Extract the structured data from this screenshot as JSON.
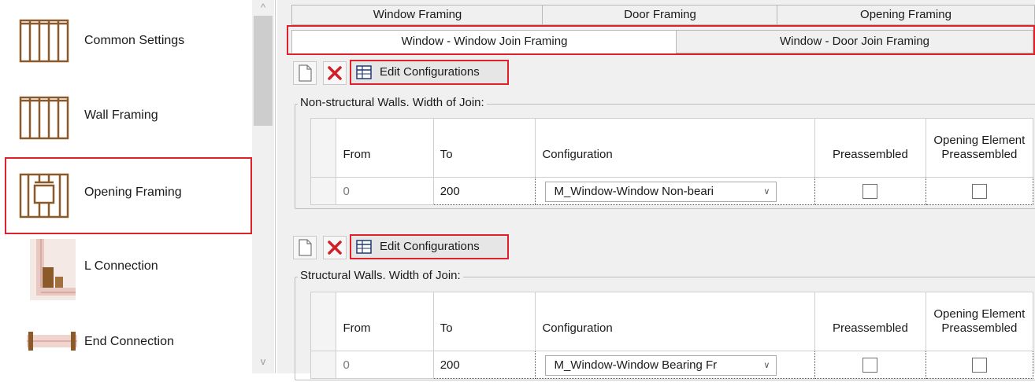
{
  "sidebar": {
    "items": [
      {
        "label": "Common Settings",
        "icon": "wall-framing-icon"
      },
      {
        "label": "Wall Framing",
        "icon": "wall-framing-icon"
      },
      {
        "label": "Opening Framing",
        "icon": "opening-framing-icon"
      },
      {
        "label": "L Connection",
        "icon": "l-connection-icon"
      },
      {
        "label": "End Connection",
        "icon": "end-connection-icon"
      }
    ],
    "scroll_up": "^",
    "scroll_down": "v"
  },
  "tabs": {
    "top": [
      "Window Framing",
      "Door Framing",
      "Opening Framing"
    ],
    "sub": [
      "Window - Window Join Framing",
      "Window - Door Join Framing"
    ]
  },
  "toolbar": {
    "edit_label": "Edit Configurations"
  },
  "sections": [
    {
      "title": "Non-structural Walls. Width of Join:",
      "columns": [
        "From",
        "To",
        "Configuration",
        "Preassembled",
        "Opening Element Preassembled"
      ],
      "row": {
        "from": "0",
        "to": "200",
        "configuration": "M_Window-Window Non-beari"
      }
    },
    {
      "title": "Structural Walls. Width of Join:",
      "columns": [
        "From",
        "To",
        "Configuration",
        "Preassembled",
        "Opening Element Preassembled"
      ],
      "row": {
        "from": "0",
        "to": "200",
        "configuration": "M_Window-Window Bearing Fr"
      }
    }
  ],
  "colors": {
    "highlight": "#e0202a",
    "wood": "#8b5a2b"
  }
}
